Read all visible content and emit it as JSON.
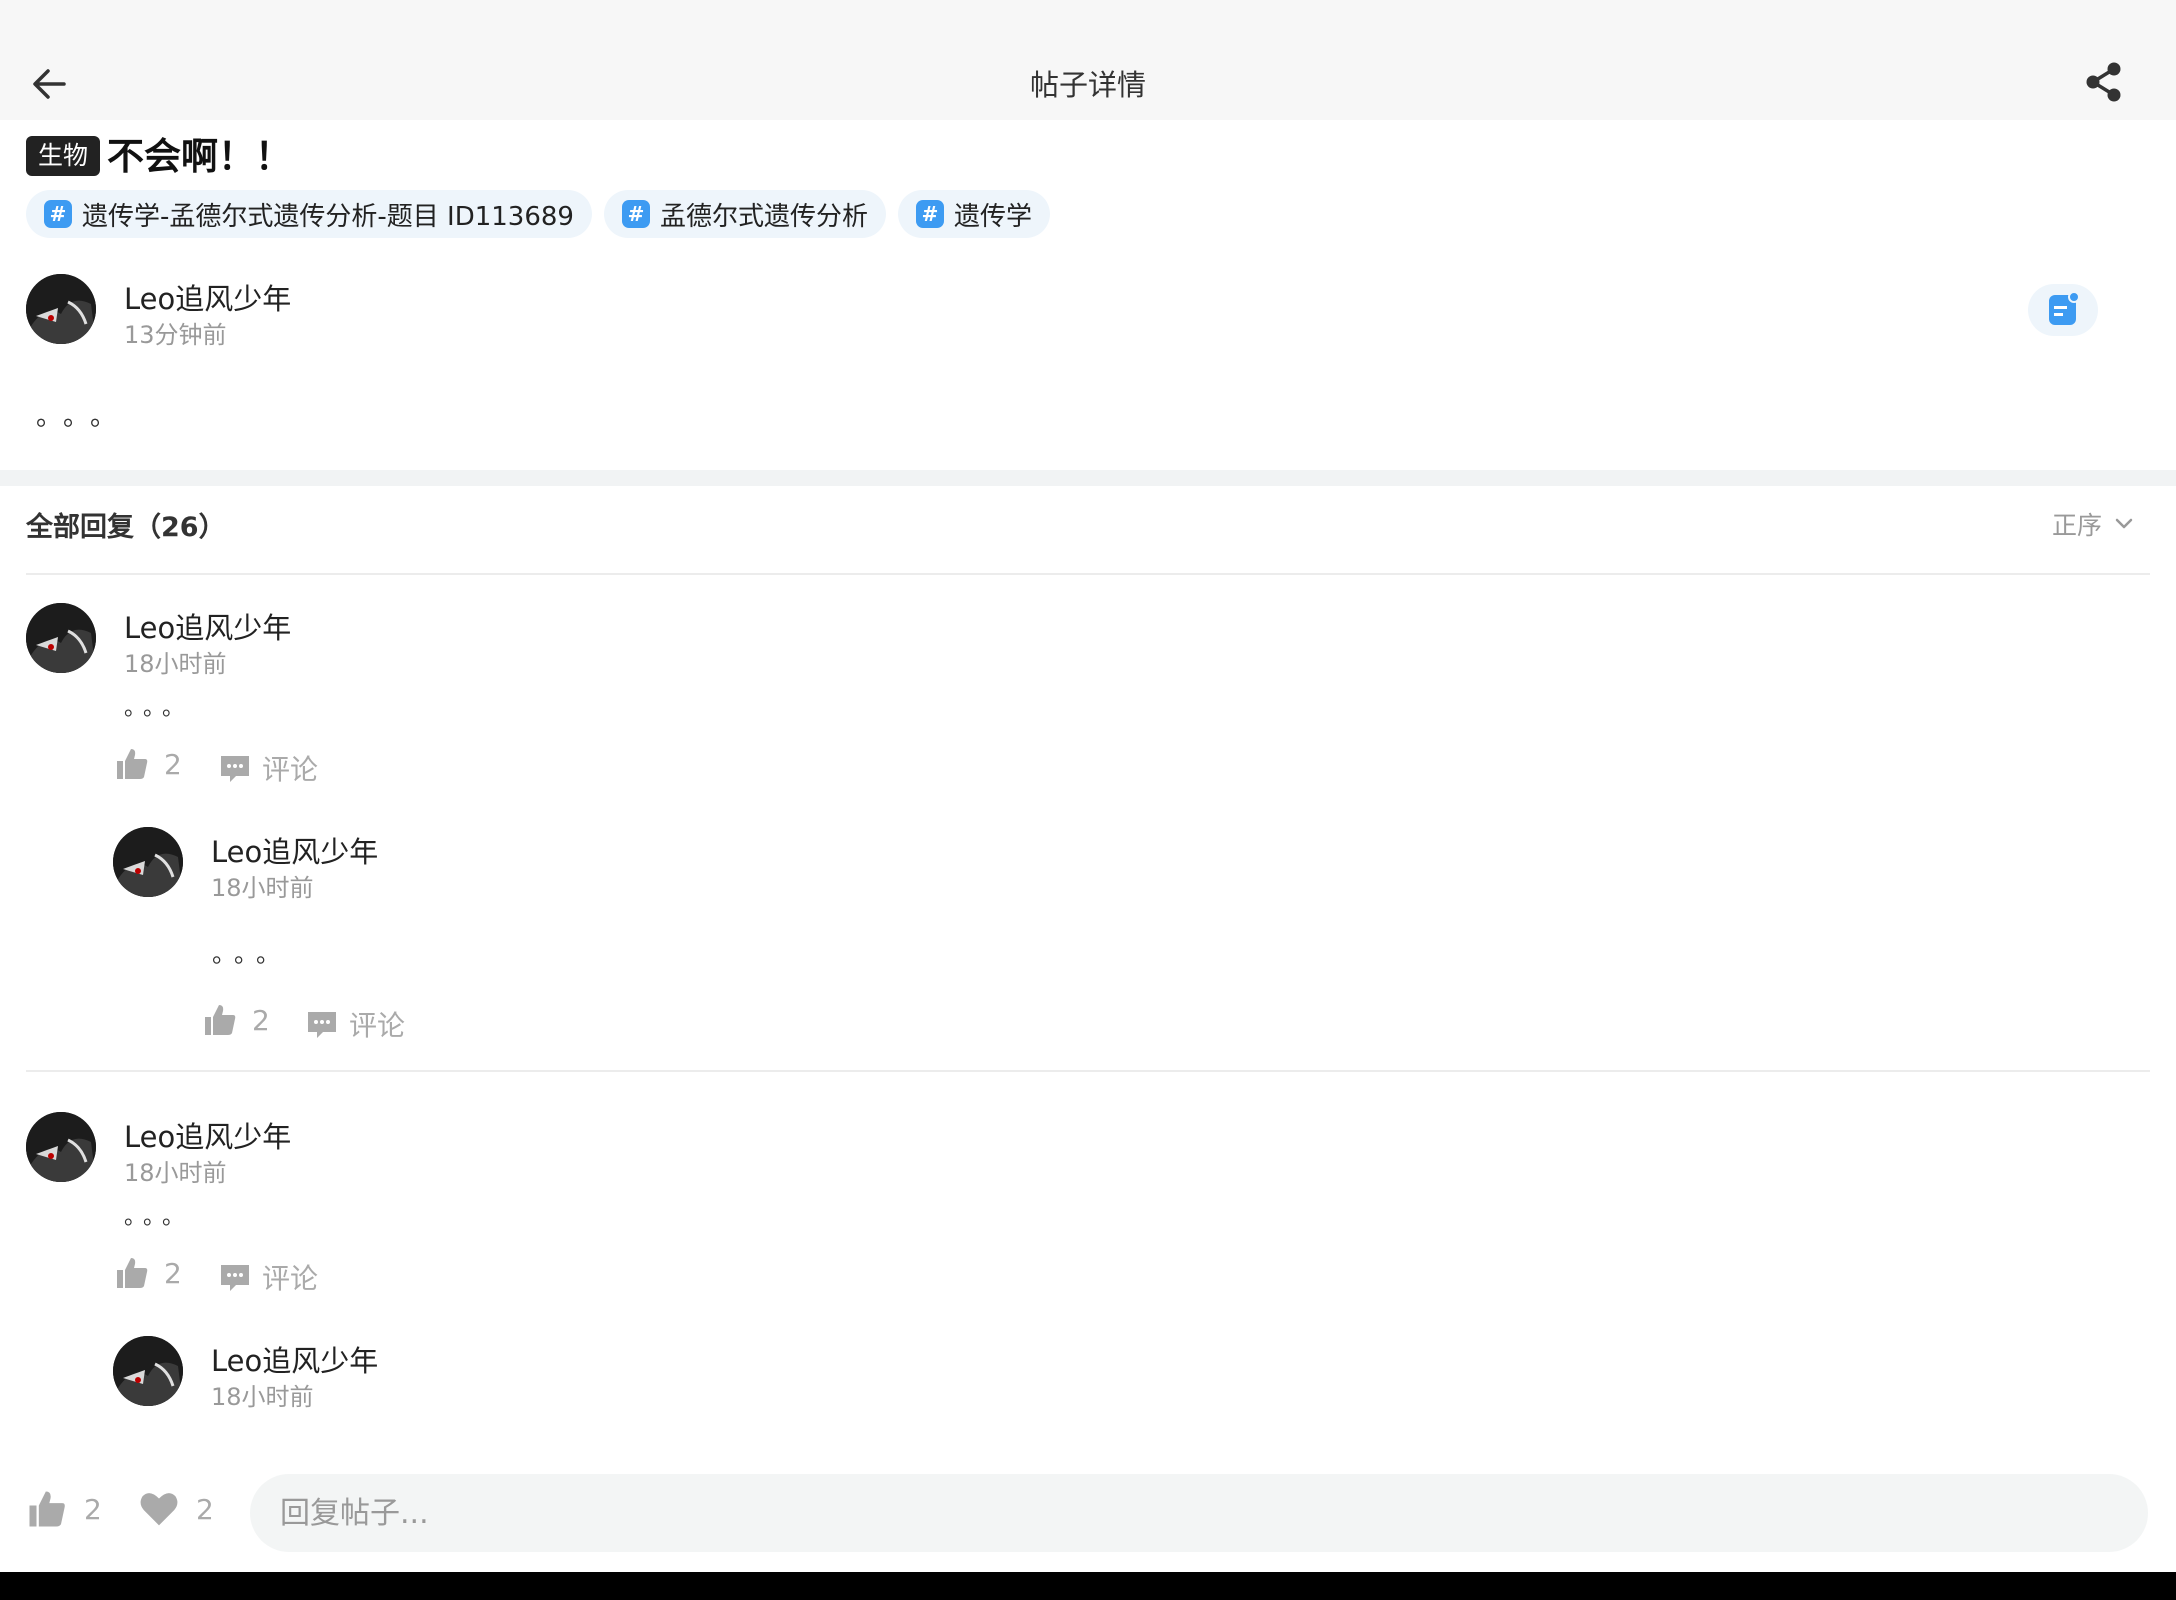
{
  "header": {
    "title": "帖子详情",
    "back_icon": "arrow-left-icon",
    "share_icon": "share-icon"
  },
  "post": {
    "subject": "生物",
    "title": "不会啊！！",
    "topics": [
      "遗传学-孟德尔式遗传分析-题目 ID113689",
      "孟德尔式遗传分析",
      "遗传学"
    ],
    "author": "Leo追风少年",
    "time": "13分钟前",
    "content": "。。。"
  },
  "replies_header": {
    "title": "全部回复（26）",
    "sort": "正序"
  },
  "replies": [
    {
      "author": "Leo追风少年",
      "time": "18小时前",
      "content": "。。。",
      "likes": "2",
      "comment_label": "评论",
      "sub": {
        "author": "Leo追风少年",
        "time": "18小时前",
        "content": "。。。",
        "likes": "2",
        "comment_label": "评论"
      }
    },
    {
      "author": "Leo追风少年",
      "time": "18小时前",
      "content": "。。。",
      "likes": "2",
      "comment_label": "评论",
      "sub": {
        "author": "Leo追风少年",
        "time": "18小时前"
      }
    }
  ],
  "bottom_bar": {
    "likes": "2",
    "favorites": "2",
    "reply_placeholder": "回复帖子..."
  },
  "colors": {
    "accent": "#3d9bf2",
    "tag_bg": "#eef5fb",
    "muted": "#999999",
    "dark_tag": "#222222"
  }
}
